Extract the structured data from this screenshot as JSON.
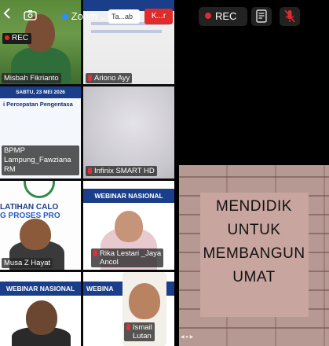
{
  "toolbar": {
    "zoom_label": "Zoom",
    "search_value": "Ta...ab",
    "end_label": "K...r",
    "rec_label": "REC"
  },
  "participants": [
    {
      "name": "Misbah Fikrianto",
      "muted": false
    },
    {
      "name": "Ariono Ayy",
      "muted": true
    },
    {
      "name_line1": "BPMP",
      "name_line2": "Lampung_Fawziana",
      "name_line3": "RM",
      "muted": false
    },
    {
      "name": "Infinix SMART HD",
      "muted": true
    },
    {
      "name": "Musa Z Hayat",
      "muted": false
    },
    {
      "name_line1": "Rika Lestari _Jaya",
      "name_line2": "Ancol",
      "muted": true
    },
    {
      "name": "",
      "muted": false
    },
    {
      "name_line1": "Ismail",
      "name_line2": "Lutan",
      "muted": true
    }
  ],
  "tiles": {
    "t3_date": "SABTU, 23 MEI 2026",
    "t3_title": "i Percepatan Pengentasa",
    "t5_title_line1": "LATIHAN CALO",
    "t5_title_line2": "G PROSES PRO",
    "t6_banner": "WEBINAR NASIONAL",
    "t7_banner": "WEBINAR NASIONAL",
    "t8_banner": "WEBINA"
  },
  "right": {
    "rec_label": "REC",
    "poster_lines": [
      "MENDIDIK",
      "UNTUK",
      "MEMBANGUN",
      "UMAT"
    ]
  },
  "colors": {
    "rec_red": "#e02b2b",
    "banner_blue": "#1b3e8a"
  },
  "icons": [
    "back-icon",
    "camera-flip-icon",
    "zoom-chevron-icon",
    "captions-icon",
    "mic-muted-icon"
  ]
}
